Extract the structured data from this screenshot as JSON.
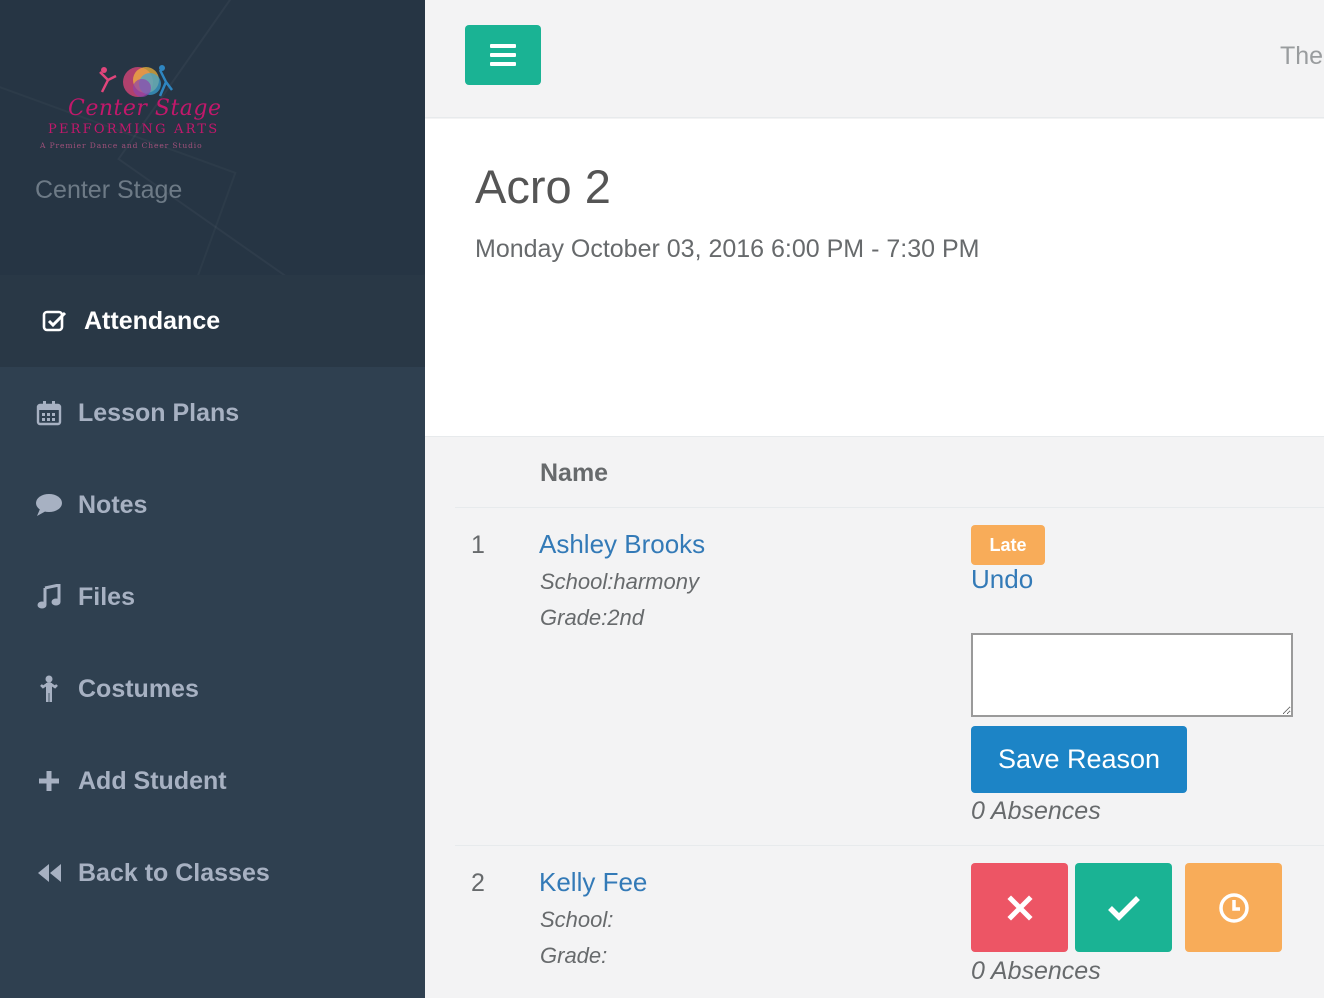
{
  "sidebar": {
    "logo": {
      "script_text": "Center Stage",
      "caps_text": "PERFORMING ARTS",
      "tagline": "A Premier Dance and Cheer Studio"
    },
    "org_name": "Center Stage",
    "items": [
      {
        "label": "Attendance",
        "icon": "check-square-icon",
        "active": true
      },
      {
        "label": "Lesson Plans",
        "icon": "calendar-icon"
      },
      {
        "label": "Notes",
        "icon": "comment-icon"
      },
      {
        "label": "Files",
        "icon": "music-icon"
      },
      {
        "label": "Costumes",
        "icon": "child-icon"
      },
      {
        "label": "Add Student",
        "icon": "plus-icon"
      },
      {
        "label": "Back to Classes",
        "icon": "backward-icon"
      }
    ]
  },
  "topbar": {
    "text": "The"
  },
  "class": {
    "title": "Acro 2",
    "datetime": "Monday October 03, 2016 6:00 PM - 7:30 PM"
  },
  "table": {
    "header_name": "Name",
    "rows": [
      {
        "num": "1",
        "name": "Ashley Brooks",
        "school": "School:harmony",
        "grade": "Grade:2nd",
        "status_badge": "Late",
        "undo_label": "Undo",
        "reason_value": "",
        "save_label": "Save Reason",
        "absences": "0 Absences"
      },
      {
        "num": "2",
        "name": "Kelly Fee",
        "school": "School:",
        "grade": "Grade:",
        "absences": "0 Absences"
      }
    ]
  },
  "colors": {
    "sidebar_bg": "#2f4050",
    "primary": "#1ab394",
    "danger": "#ed5565",
    "warning": "#f8ac59",
    "link": "#337ab7",
    "save_button": "#1c84c6"
  }
}
